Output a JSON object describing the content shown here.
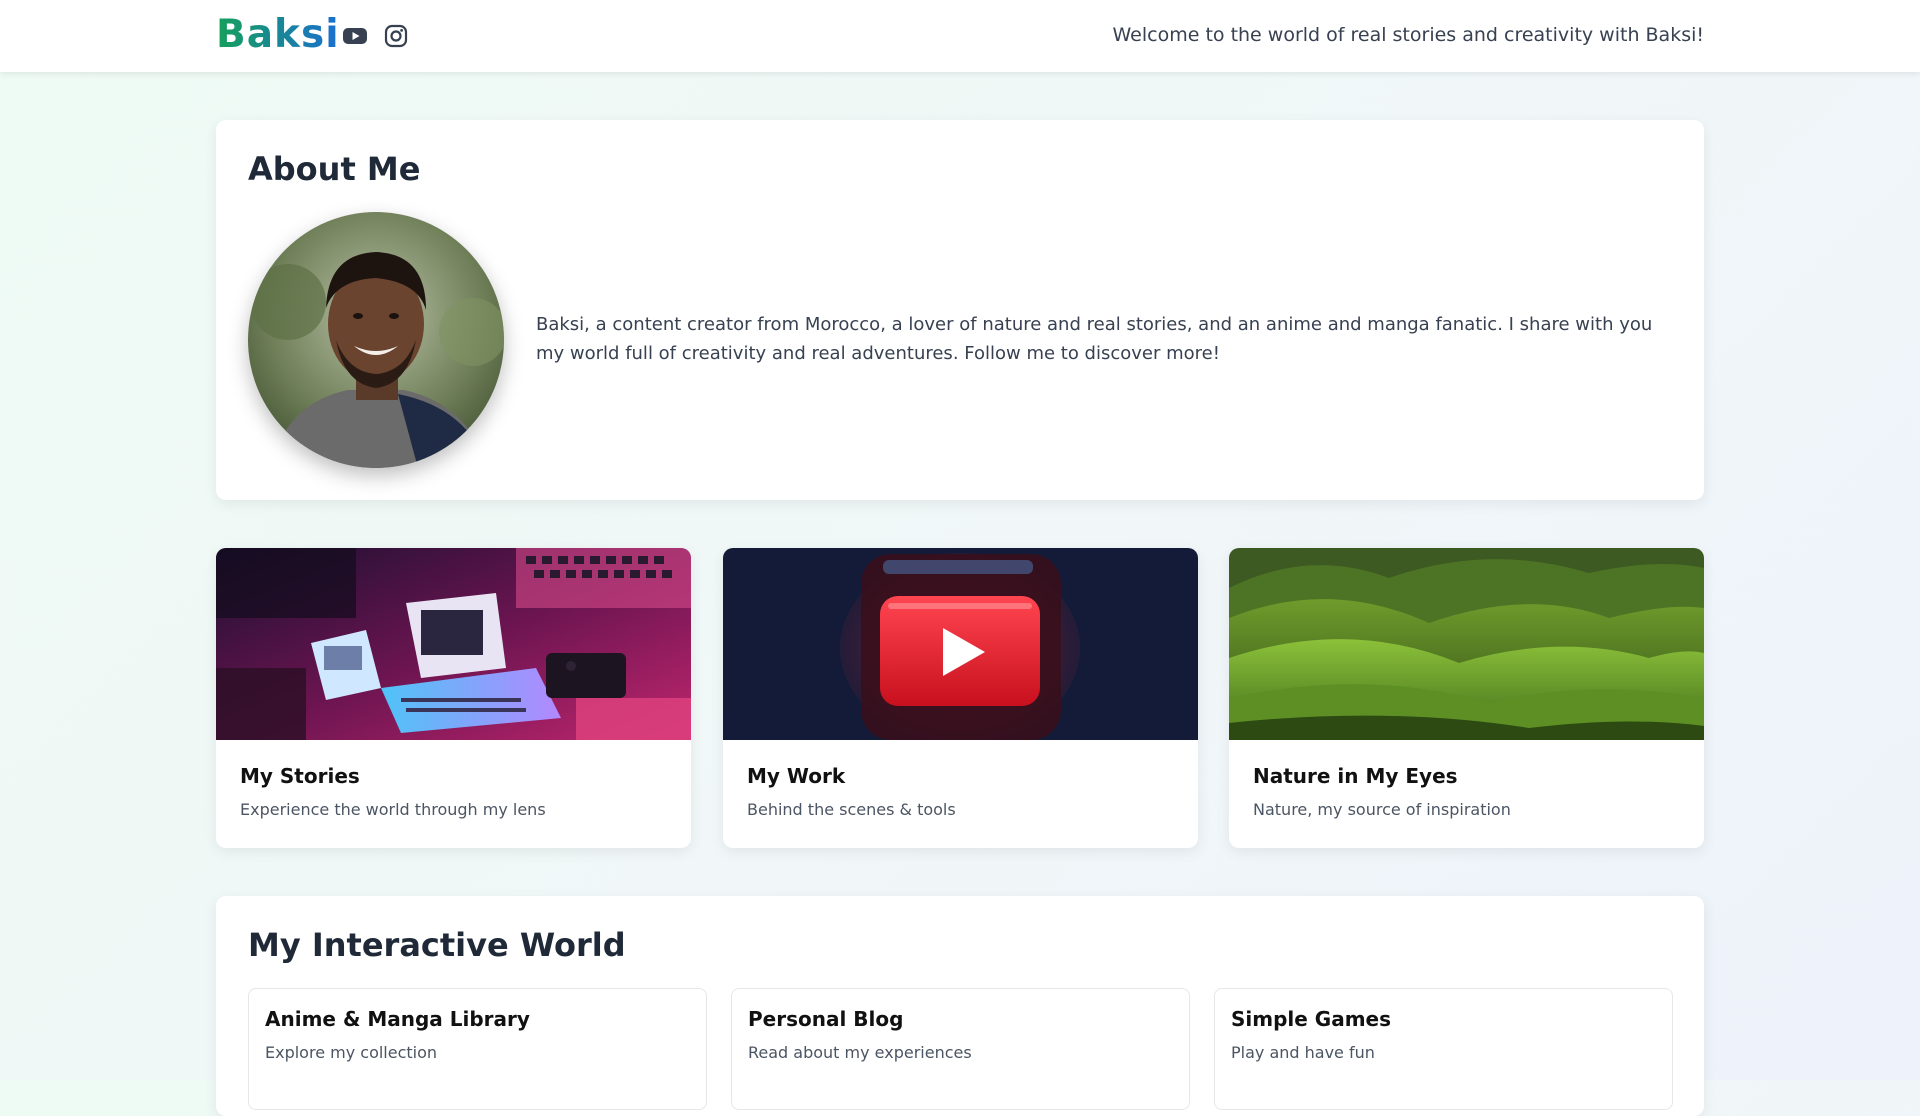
{
  "header": {
    "brand": "Baksi",
    "social": [
      {
        "icon": "youtube-icon"
      },
      {
        "icon": "instagram-icon"
      }
    ],
    "welcome": "Welcome to the world of real stories and creativity with Baksi!"
  },
  "about": {
    "title": "About Me",
    "text": "Baksi, a content creator from Morocco, a lover of nature and real stories, and an anime and manga fanatic. I share with you my world full of creativity and real adventures. Follow me to discover more!"
  },
  "features": [
    {
      "title": "My Stories",
      "subtitle": "Experience the world through my lens"
    },
    {
      "title": "My Work",
      "subtitle": "Behind the scenes & tools"
    },
    {
      "title": "Nature in My Eyes",
      "subtitle": "Nature, my source of inspiration"
    }
  ],
  "interactive": {
    "title": "My Interactive World",
    "items": [
      {
        "title": "Anime & Manga Library",
        "subtitle": "Explore my collection"
      },
      {
        "title": "Personal Blog",
        "subtitle": "Read about my experiences"
      },
      {
        "title": "Simple Games",
        "subtitle": "Play and have fun"
      }
    ]
  },
  "colors": {
    "brand_green": "#16a05a",
    "brand_blue": "#1b6fd1",
    "youtube_red": "#e8222a"
  }
}
